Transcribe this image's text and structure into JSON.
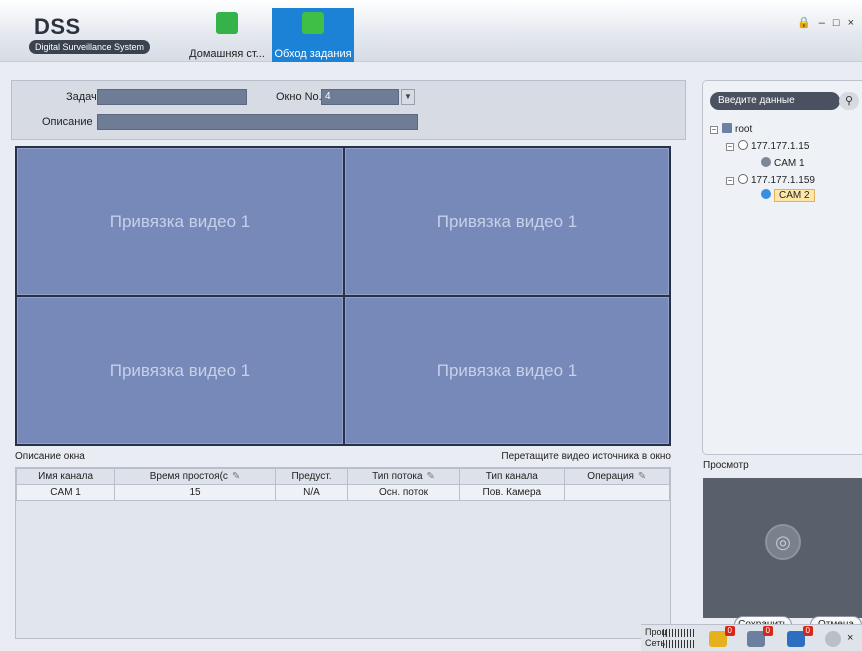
{
  "app": {
    "logo_title": "DSS",
    "logo_subtitle": "Digital Surveillance System"
  },
  "tabs": [
    {
      "label": "Домашняя ст...",
      "icon": "home-icon",
      "active": false
    },
    {
      "label": "Обход задания",
      "icon": "task-tour-icon",
      "active": true
    }
  ],
  "window_controls": {
    "lock": "🔒",
    "minimize": "–",
    "maximize": "□",
    "close": "×"
  },
  "form": {
    "task_label": "Задача",
    "task_value": "",
    "window_no_label": "Окно No.",
    "window_no_value": "4",
    "description_label": "Описание",
    "description_value": ""
  },
  "video_cells": [
    {
      "label": "Привязка видео 1"
    },
    {
      "label": "Привязка видео 1"
    },
    {
      "label": "Привязка видео 1"
    },
    {
      "label": "Привязка видео 1"
    }
  ],
  "window_desc": {
    "title": "Описание окна",
    "hint": "Перетащите видео источника в окно"
  },
  "table": {
    "columns": [
      "Имя канала",
      "Время простоя(с",
      "Предуст.",
      "Тип потока",
      "Тип канала",
      "Операция"
    ],
    "rows": [
      [
        "CAM 1",
        "15",
        "N/A",
        "Осн. поток",
        "Пов. Камера",
        ""
      ]
    ]
  },
  "tree": {
    "search_placeholder": "Введите данные",
    "nodes": [
      {
        "label": "root",
        "icon": "org-tree-icon"
      },
      {
        "label": "177.177.1.15",
        "icon": "device-icon"
      },
      {
        "label": "CAM 1",
        "icon": "camera-icon"
      },
      {
        "label": "177.177.1.159",
        "icon": "device-icon"
      },
      {
        "label": "CAM 2",
        "icon": "camera-icon",
        "selected": true
      }
    ]
  },
  "preview": {
    "label": "Просмотр",
    "icon": "camera-placeholder-icon"
  },
  "buttons": {
    "save": "Сохранить",
    "cancel": "Отмена"
  },
  "statusbar": {
    "cpu_label": "Проц",
    "net_label": "Сеть",
    "badges": [
      "0",
      "0",
      "0"
    ],
    "close": "×"
  },
  "colors": {
    "active_tab": "#1b82d6",
    "video_cell": "#7789b9",
    "badge": "#d7271a",
    "selection": "#fde7a8"
  }
}
